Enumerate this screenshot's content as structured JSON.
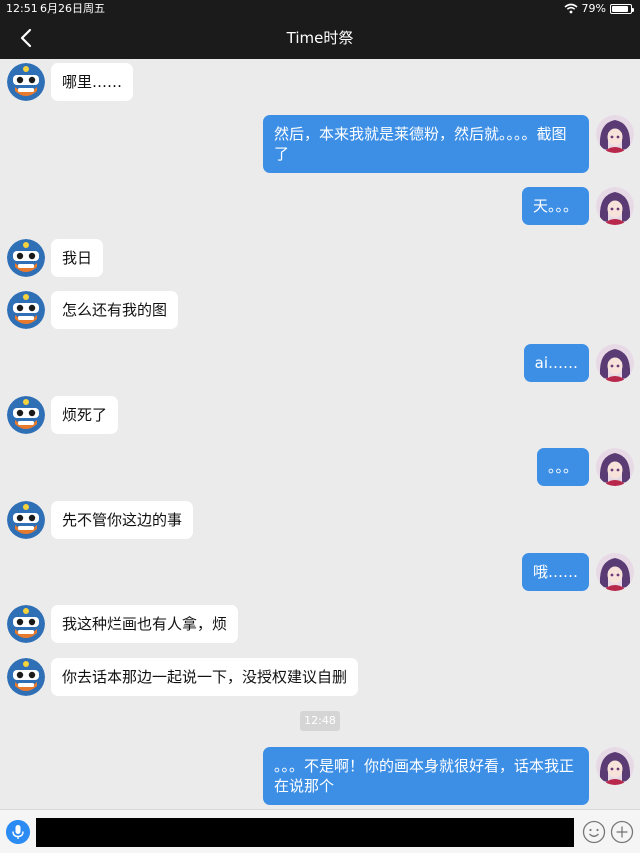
{
  "status_bar": {
    "time": "12:51",
    "date": "6月26日周五",
    "battery": "79%",
    "battery_level": 0.79
  },
  "header": {
    "title": "Time时祭",
    "back_icon": "chevron-left-icon"
  },
  "messages": [
    {
      "side": "left",
      "text": "哪里……"
    },
    {
      "side": "right",
      "text": "然后，本来我就是莱德粉，然后就。。。。截图了"
    },
    {
      "side": "right",
      "text": "天。。。"
    },
    {
      "side": "left",
      "text": "我日"
    },
    {
      "side": "left",
      "text": "怎么还有我的图"
    },
    {
      "side": "right",
      "text": "ai……"
    },
    {
      "side": "left",
      "text": "烦死了"
    },
    {
      "side": "right",
      "text": "。。。"
    },
    {
      "side": "left",
      "text": "先不管你这边的事"
    },
    {
      "side": "right",
      "text": "哦……"
    },
    {
      "side": "left",
      "text": "我这种烂画也有人拿，烦"
    },
    {
      "side": "left",
      "text": "你去话本那边一起说一下，没授权建议自删"
    },
    {
      "side": "right",
      "text": "。。。不是啊！你的画本身就很好看，话本我正在说那个"
    }
  ],
  "timestamp": "12:48",
  "input_bar": {
    "voice_icon": "microphone-icon",
    "emoji_icon": "smiley-icon",
    "plus_icon": "plus-icon",
    "value": ""
  },
  "colors": {
    "outgoing_bubble": "#3d8fe6",
    "incoming_bubble": "#ffffff",
    "background": "#ebebeb",
    "header": "#1b1b1b"
  }
}
